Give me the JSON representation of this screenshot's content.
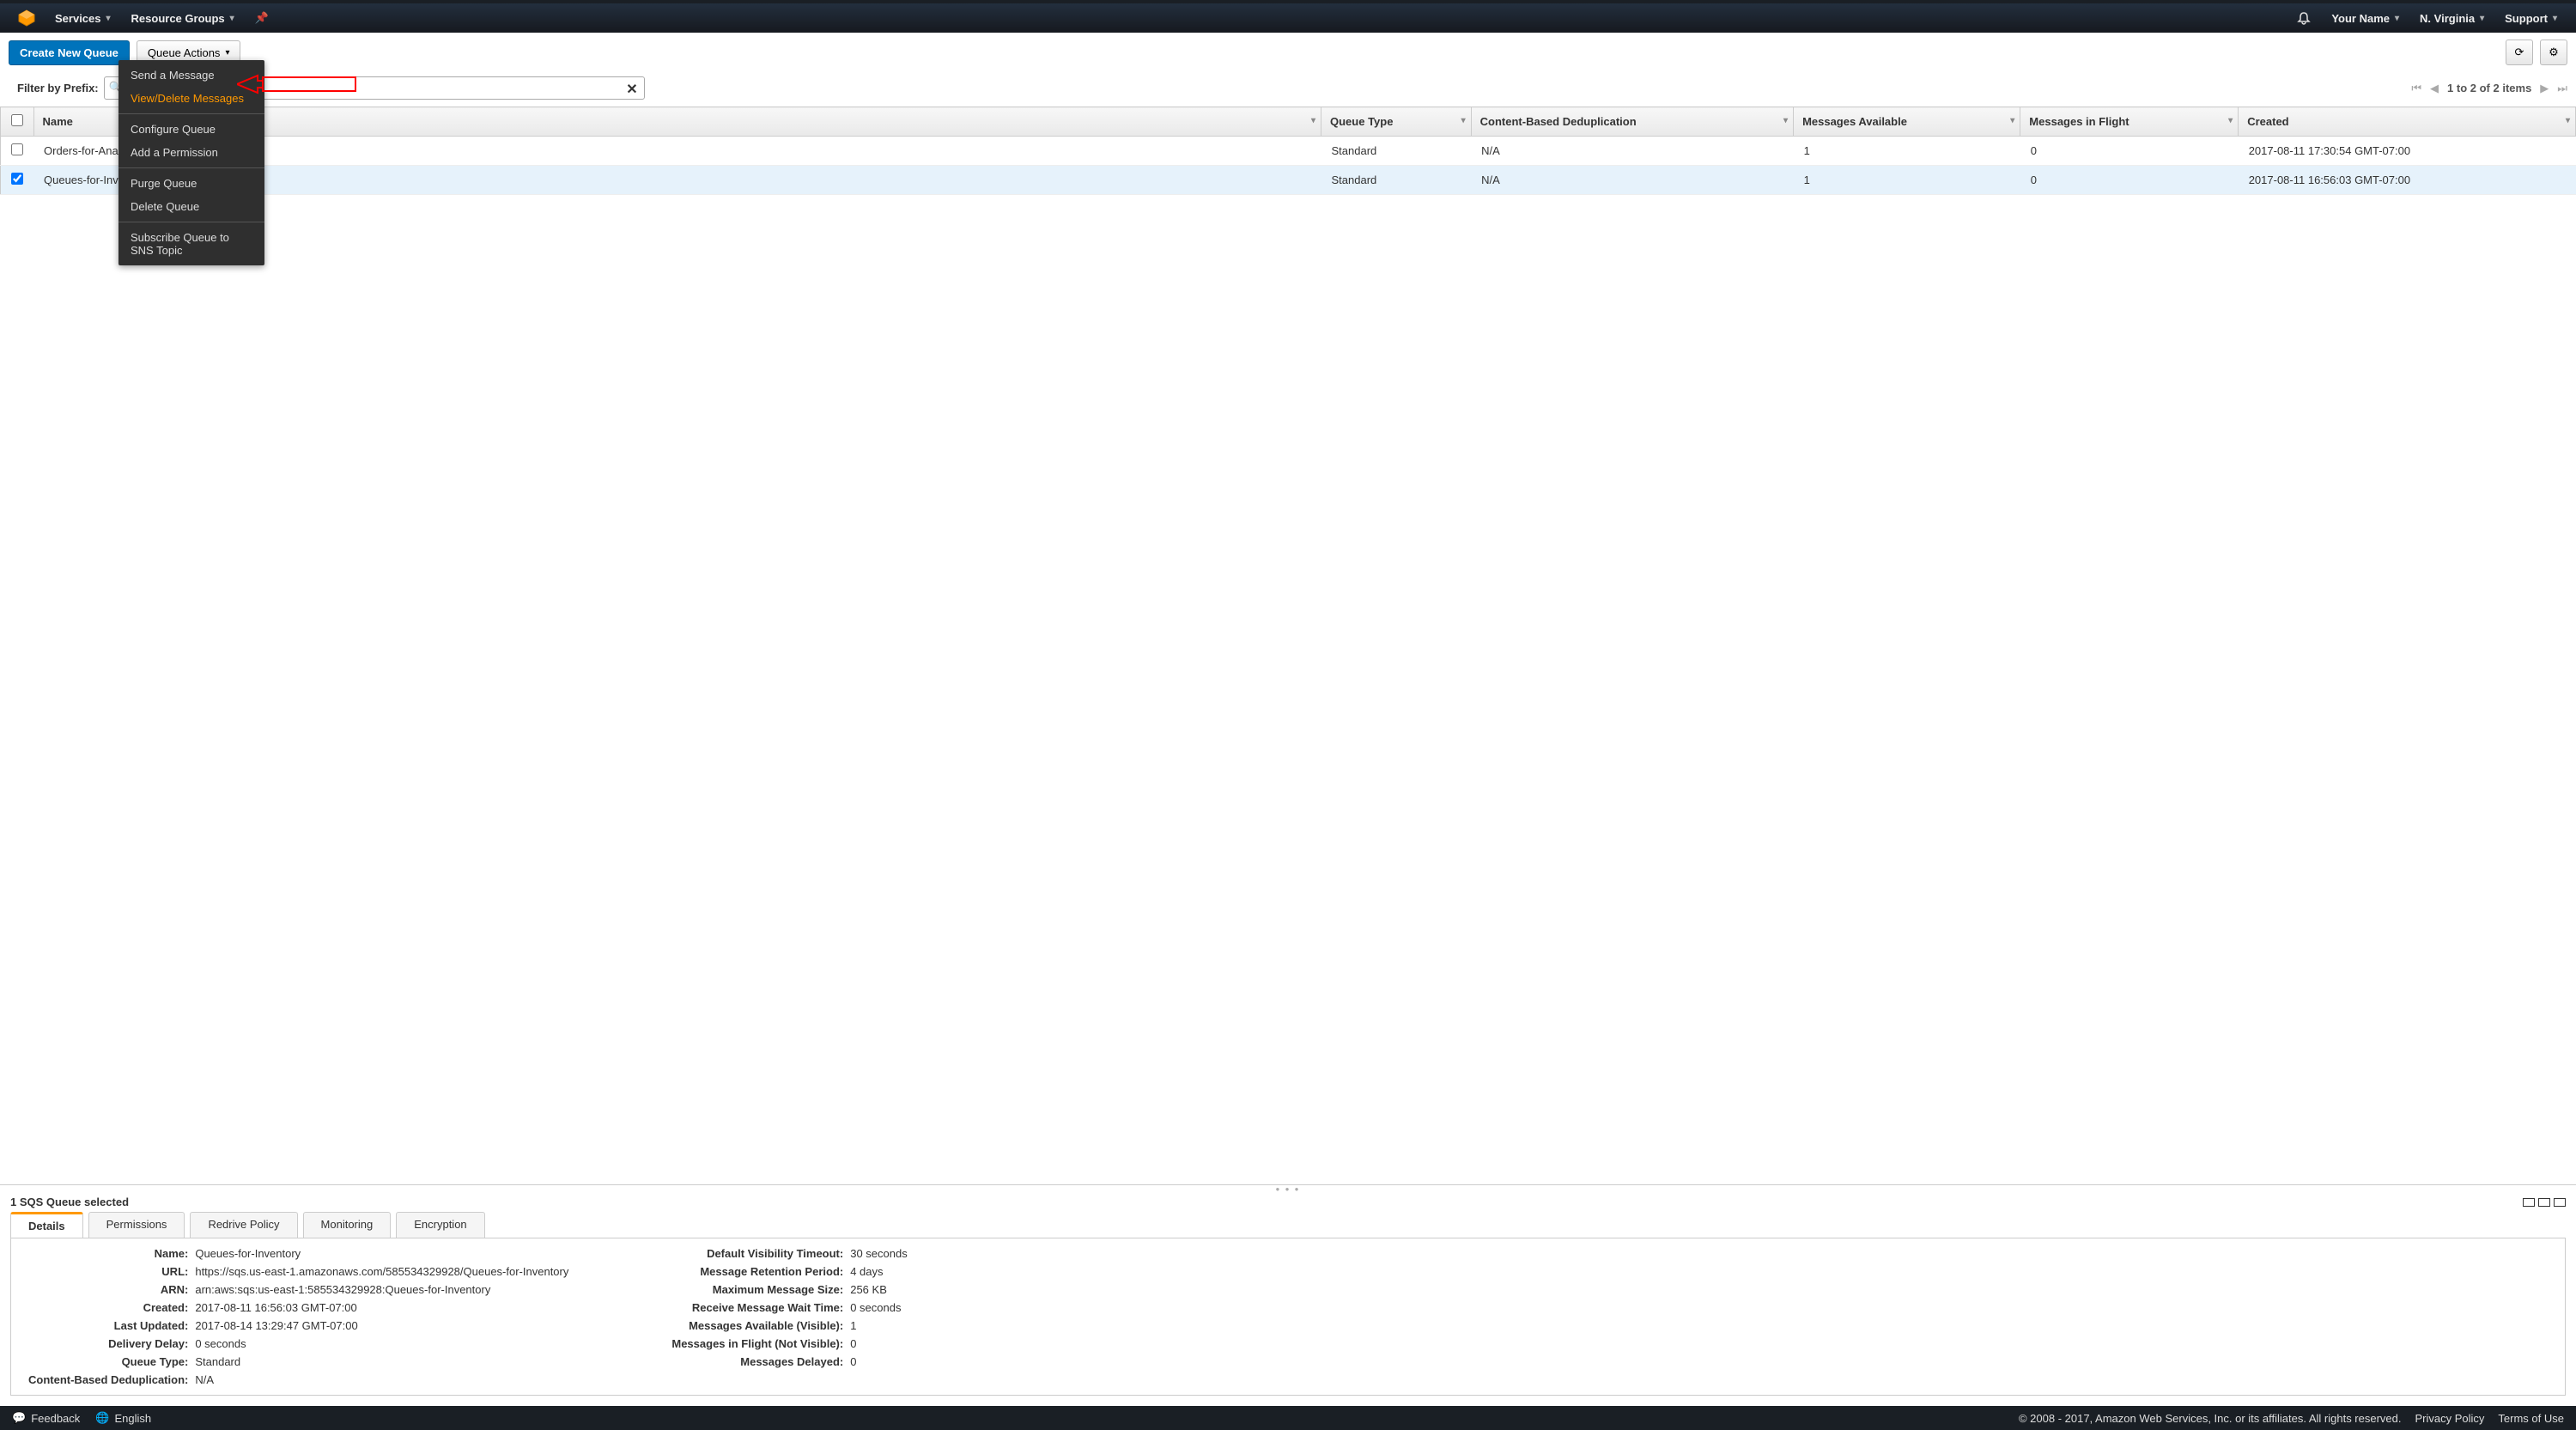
{
  "topnav": {
    "services": "Services",
    "resource_groups": "Resource Groups",
    "your_name": "Your Name",
    "region": "N. Virginia",
    "support": "Support"
  },
  "toolbar": {
    "create": "Create New Queue",
    "queue_actions": "Queue Actions"
  },
  "filter": {
    "label": "Filter by Prefix:",
    "placeholder": "Ente",
    "pager_text": "1 to 2 of 2 items"
  },
  "dropdown": {
    "send": "Send a Message",
    "view_delete": "View/Delete Messages",
    "configure": "Configure Queue",
    "add_perm": "Add a Permission",
    "purge": "Purge Queue",
    "delete": "Delete Queue",
    "subscribe": "Subscribe Queue to SNS Topic"
  },
  "columns": {
    "name": "Name",
    "type": "Queue Type",
    "dedup": "Content-Based Deduplication",
    "avail": "Messages Available",
    "inflight": "Messages in Flight",
    "created": "Created"
  },
  "rows": [
    {
      "name": "Orders-for-Analytics",
      "type": "Standard",
      "dedup": "N/A",
      "avail": "1",
      "inflight": "0",
      "created": "2017-08-11 17:30:54 GMT-07:00",
      "selected": false
    },
    {
      "name": "Queues-for-Inventory",
      "type": "Standard",
      "dedup": "N/A",
      "avail": "1",
      "inflight": "0",
      "created": "2017-08-11 16:56:03 GMT-07:00",
      "selected": true
    }
  ],
  "details": {
    "selected_text": "1 SQS Queue selected",
    "tabs": {
      "details": "Details",
      "permissions": "Permissions",
      "redrive": "Redrive Policy",
      "monitoring": "Monitoring",
      "encryption": "Encryption"
    },
    "left": {
      "Name": "Queues-for-Inventory",
      "URL": "https://sqs.us-east-1.amazonaws.com/585534329928/Queues-for-Inventory",
      "ARN": "arn:aws:sqs:us-east-1:585534329928:Queues-for-Inventory",
      "Created": "2017-08-11 16:56:03 GMT-07:00",
      "Last_Updated": "2017-08-14 13:29:47 GMT-07:00",
      "Delivery_Delay": "0 seconds",
      "Queue_Type": "Standard",
      "Content_Based_Deduplication": "N/A"
    },
    "left_labels": {
      "Name": "Name:",
      "URL": "URL:",
      "ARN": "ARN:",
      "Created": "Created:",
      "Last_Updated": "Last Updated:",
      "Delivery_Delay": "Delivery Delay:",
      "Queue_Type": "Queue Type:",
      "Content_Based_Deduplication": "Content-Based Deduplication:"
    },
    "right": {
      "Default_Visibility_Timeout": "30 seconds",
      "Message_Retention_Period": "4 days",
      "Maximum_Message_Size": "256 KB",
      "Receive_Message_Wait_Time": "0 seconds",
      "Messages_Available_Visible": "1",
      "Messages_in_Flight_Not_Visible": "0",
      "Messages_Delayed": "0"
    },
    "right_labels": {
      "Default_Visibility_Timeout": "Default Visibility Timeout:",
      "Message_Retention_Period": "Message Retention Period:",
      "Maximum_Message_Size": "Maximum Message Size:",
      "Receive_Message_Wait_Time": "Receive Message Wait Time:",
      "Messages_Available_Visible": "Messages Available (Visible):",
      "Messages_in_Flight_Not_Visible": "Messages in Flight (Not Visible):",
      "Messages_Delayed": "Messages Delayed:"
    }
  },
  "footer": {
    "feedback": "Feedback",
    "english": "English",
    "copyright": "© 2008 - 2017, Amazon Web Services, Inc. or its affiliates. All rights reserved.",
    "privacy": "Privacy Policy",
    "terms": "Terms of Use"
  }
}
